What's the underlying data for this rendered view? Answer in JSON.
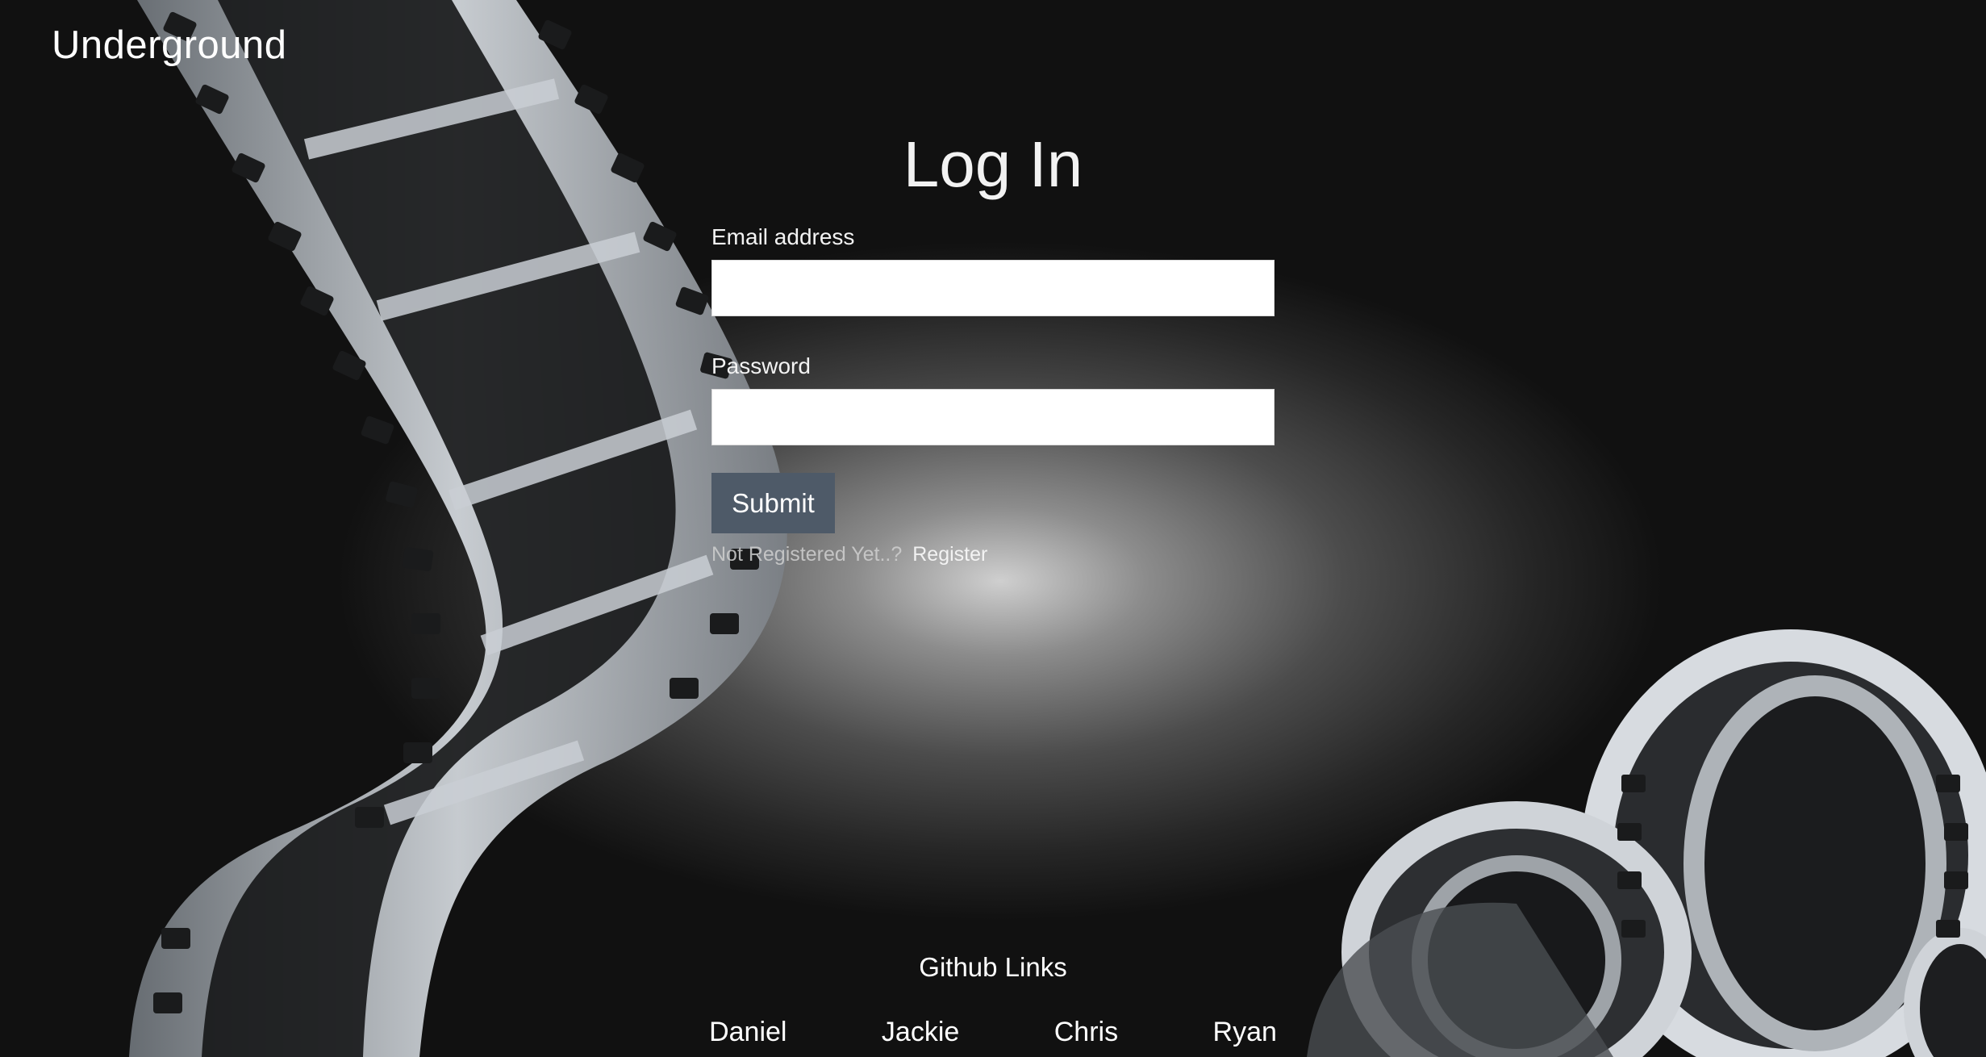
{
  "header": {
    "brand": "Underground"
  },
  "login": {
    "title": "Log In",
    "email_label": "Email address",
    "email_value": "",
    "password_label": "Password",
    "password_value": "",
    "submit_label": "Submit",
    "register_prompt": "Not Registered Yet..?",
    "register_link": "Register"
  },
  "footer": {
    "title": "Github Links",
    "links": [
      "Daniel",
      "Jackie",
      "Chris",
      "Ryan"
    ]
  },
  "colors": {
    "submit_button": "#4e5a68",
    "background_glow": "#cfcfcf"
  },
  "icons": {
    "background_left": "film-strip-icon",
    "background_right": "film-reel-icon"
  }
}
